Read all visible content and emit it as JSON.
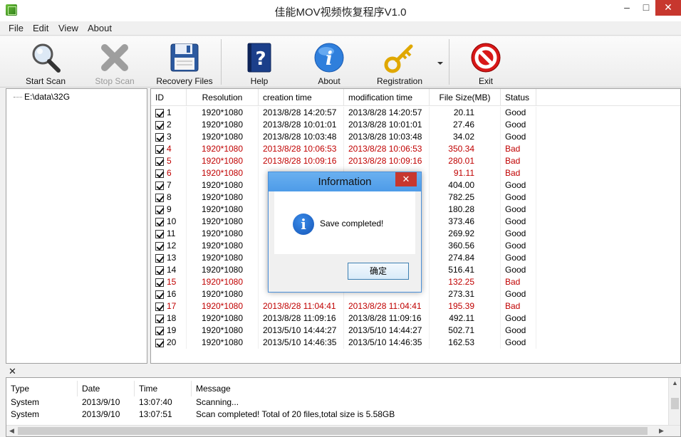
{
  "window": {
    "title": "佳能MOV视频恢复程序V1.0"
  },
  "menu": [
    "File",
    "Edit",
    "View",
    "About"
  ],
  "toolbar": [
    {
      "label": "Start Scan",
      "icon": "magnifier-icon",
      "enabled": true
    },
    {
      "label": "Stop Scan",
      "icon": "stop-x-icon",
      "enabled": false
    },
    {
      "label": "Recovery  Files",
      "icon": "floppy-disk-icon",
      "enabled": true
    },
    {
      "label": "Help",
      "icon": "help-book-icon",
      "enabled": true
    },
    {
      "label": "About",
      "icon": "info-icon",
      "enabled": true
    },
    {
      "label": "Registration",
      "icon": "key-icon",
      "enabled": true
    },
    {
      "label": "Exit",
      "icon": "exit-icon",
      "enabled": true
    }
  ],
  "tree": {
    "root": "E:\\data\\32G"
  },
  "table": {
    "headers": [
      "ID",
      "Resolution",
      "creation time",
      "modification time",
      "File Size(MB)",
      "Status"
    ],
    "rows": [
      {
        "id": "1",
        "res": "1920*1080",
        "ct": "2013/8/28 14:20:57",
        "mt": "2013/8/28 14:20:57",
        "size": "20.11",
        "status": "Good"
      },
      {
        "id": "2",
        "res": "1920*1080",
        "ct": "2013/8/28 10:01:01",
        "mt": "2013/8/28 10:01:01",
        "size": "27.46",
        "status": "Good"
      },
      {
        "id": "3",
        "res": "1920*1080",
        "ct": "2013/8/28 10:03:48",
        "mt": "2013/8/28 10:03:48",
        "size": "34.02",
        "status": "Good"
      },
      {
        "id": "4",
        "res": "1920*1080",
        "ct": "2013/8/28 10:06:53",
        "mt": "2013/8/28 10:06:53",
        "size": "350.34",
        "status": "Bad"
      },
      {
        "id": "5",
        "res": "1920*1080",
        "ct": "2013/8/28 10:09:16",
        "mt": "2013/8/28 10:09:16",
        "size": "280.01",
        "status": "Bad"
      },
      {
        "id": "6",
        "res": "1920*1080",
        "ct": "",
        "mt": "",
        "size": "91.11",
        "status": "Bad"
      },
      {
        "id": "7",
        "res": "1920*1080",
        "ct": "",
        "mt": "",
        "size": "404.00",
        "status": "Good"
      },
      {
        "id": "8",
        "res": "1920*1080",
        "ct": "",
        "mt": "",
        "size": "782.25",
        "status": "Good"
      },
      {
        "id": "9",
        "res": "1920*1080",
        "ct": "",
        "mt": "",
        "size": "180.28",
        "status": "Good"
      },
      {
        "id": "10",
        "res": "1920*1080",
        "ct": "",
        "mt": "",
        "size": "373.46",
        "status": "Good"
      },
      {
        "id": "11",
        "res": "1920*1080",
        "ct": "",
        "mt": "",
        "size": "269.92",
        "status": "Good"
      },
      {
        "id": "12",
        "res": "1920*1080",
        "ct": "",
        "mt": "",
        "size": "360.56",
        "status": "Good"
      },
      {
        "id": "13",
        "res": "1920*1080",
        "ct": "",
        "mt": "",
        "size": "274.84",
        "status": "Good"
      },
      {
        "id": "14",
        "res": "1920*1080",
        "ct": "",
        "mt": "",
        "size": "516.41",
        "status": "Good"
      },
      {
        "id": "15",
        "res": "1920*1080",
        "ct": "",
        "mt": "",
        "size": "132.25",
        "status": "Bad"
      },
      {
        "id": "16",
        "res": "1920*1080",
        "ct": "",
        "mt": "",
        "size": "273.31",
        "status": "Good"
      },
      {
        "id": "17",
        "res": "1920*1080",
        "ct": "2013/8/28 11:04:41",
        "mt": "2013/8/28 11:04:41",
        "size": "195.39",
        "status": "Bad"
      },
      {
        "id": "18",
        "res": "1920*1080",
        "ct": "2013/8/28 11:09:16",
        "mt": "2013/8/28 11:09:16",
        "size": "492.11",
        "status": "Good"
      },
      {
        "id": "19",
        "res": "1920*1080",
        "ct": "2013/5/10 14:44:27",
        "mt": "2013/5/10 14:44:27",
        "size": "502.71",
        "status": "Good"
      },
      {
        "id": "20",
        "res": "1920*1080",
        "ct": "2013/5/10 14:46:35",
        "mt": "2013/5/10 14:46:35",
        "size": "162.53",
        "status": "Good"
      }
    ]
  },
  "dialog": {
    "title": "Information",
    "message": "Save completed!",
    "ok": "确定"
  },
  "log": {
    "headers": [
      "Type",
      "Date",
      "Time",
      "Message"
    ],
    "rows": [
      {
        "type": "System",
        "date": "2013/9/10",
        "time": "13:07:40",
        "msg": "Scanning..."
      },
      {
        "type": "System",
        "date": "2013/9/10",
        "time": "13:07:51",
        "msg": "Scan completed! Total of 20 files,total size is 5.58GB"
      }
    ]
  },
  "colors": {
    "bad": "#c00000",
    "dialog_title": "#5aa5ec",
    "close_red": "#c7372e"
  }
}
